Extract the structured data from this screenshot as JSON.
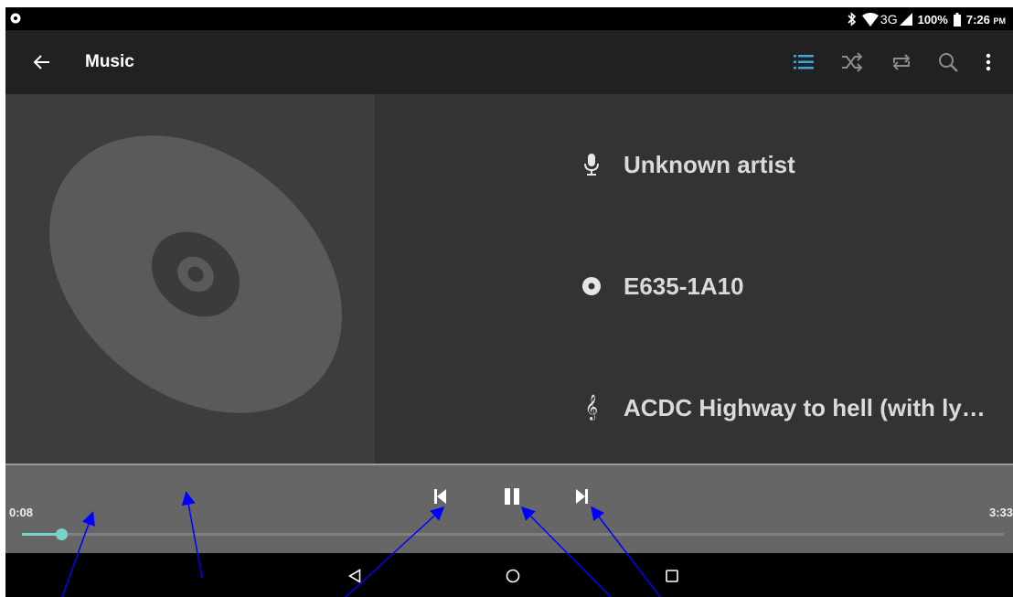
{
  "status_bar": {
    "network": "3G",
    "battery": "100%",
    "time": "7:26",
    "ampm": "PM"
  },
  "app_bar": {
    "title": "Music",
    "icons": [
      "back-arrow-icon",
      "playlist-icon",
      "shuffle-icon",
      "repeat-icon",
      "search-icon",
      "more-vert-icon"
    ]
  },
  "track": {
    "artist": "Unknown artist",
    "album": "E635-1A10",
    "title": "ACDC Highway to hell (with ly…"
  },
  "player": {
    "elapsed": "0:08",
    "duration": "3:33",
    "progress_fraction": 0.04
  },
  "colors": {
    "accent": "#76d4c8",
    "active_icon": "#3aa6dd",
    "annotation_arrow": "#0000ff"
  }
}
